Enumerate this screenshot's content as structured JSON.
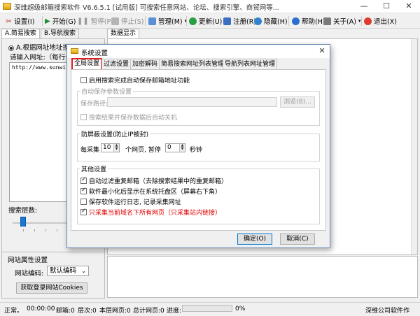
{
  "window": {
    "title": "深维超级邮箱搜索软件 V6.6.5.1 [试用版] 可搜索任意网站、论坛、搜索引擎、商贸网等...",
    "minimize": "—",
    "maximize": "☐",
    "close": "✕"
  },
  "toolbar": {
    "settings": "设置(I)",
    "start": "开始(G)",
    "pause": "暂停(P)",
    "stop": "停止(S)",
    "manage": "管理(M)",
    "update": "更新(U)",
    "register": "注册(R)",
    "hide": "隐藏(H)",
    "help": "帮助(H)",
    "about": "关于(A)",
    "exit": "退出(X)"
  },
  "left": {
    "tabs": [
      "A.简易搜索",
      "B.导航搜索"
    ],
    "mode_label": "A.根据网址地址搜",
    "url_prompt": "请输入网址:（每行一",
    "url_value": "http://www.sunwill.",
    "depth_label": "搜索层数:",
    "depth_level": 2,
    "site_props_title": "网站属性设置",
    "encoding_label": "网站编码:",
    "encoding_value": "默认编码",
    "cookies_button": "获取登录网站Cookies"
  },
  "right": {
    "data_tab": "数据显示"
  },
  "status": {
    "state": "正常。",
    "elapsed": "00:00:00",
    "mailbox": "邮箱:0",
    "depth": "层次:0",
    "page_of_site": "本层网页:0",
    "total_pages": "总计网页:0",
    "progress_label": "进度:",
    "progress_value": "0%",
    "company": "深维公司软件作"
  },
  "dialog": {
    "title": "系统设置",
    "close": "✕",
    "tabs": [
      "全局设置",
      "过滤设置",
      "加密解码",
      "简易搜索网址列表管理",
      "导航列表网址管理"
    ],
    "auto_save_option": "启用搜索完成自动保存邮箱地址功能",
    "auto_save_group": "自动保存参数设置",
    "save_path_label": "保存路径:",
    "browse_button": "浏览(B)...",
    "auto_shutdown": "搜索结果并保存数据后自动关机",
    "anti_block_group": "防屏蔽设置(防止IP被封)",
    "every_label": "每采集",
    "every_value": "10",
    "pages_pause_label": "个网页, 暂停",
    "pause_value": "0",
    "seconds_label": "秒钟",
    "other_group": "其他设置",
    "opt_dedup": "自动过滤重复邮箱（去除搜索结果中的重复邮箱）",
    "opt_tray": "软件最小化后显示在系统托盘区（屏幕右下角）",
    "opt_log": "保存软件运行日志, 记录采集网址",
    "opt_domain": "只采集当前域名下所有网页（只采集站内链接）",
    "ok_button": "确定(O)",
    "cancel_button": "取消(C)"
  },
  "colors": {
    "accent": "#0078d7",
    "highlight": "#e02020",
    "slider": "#1a78d8"
  }
}
